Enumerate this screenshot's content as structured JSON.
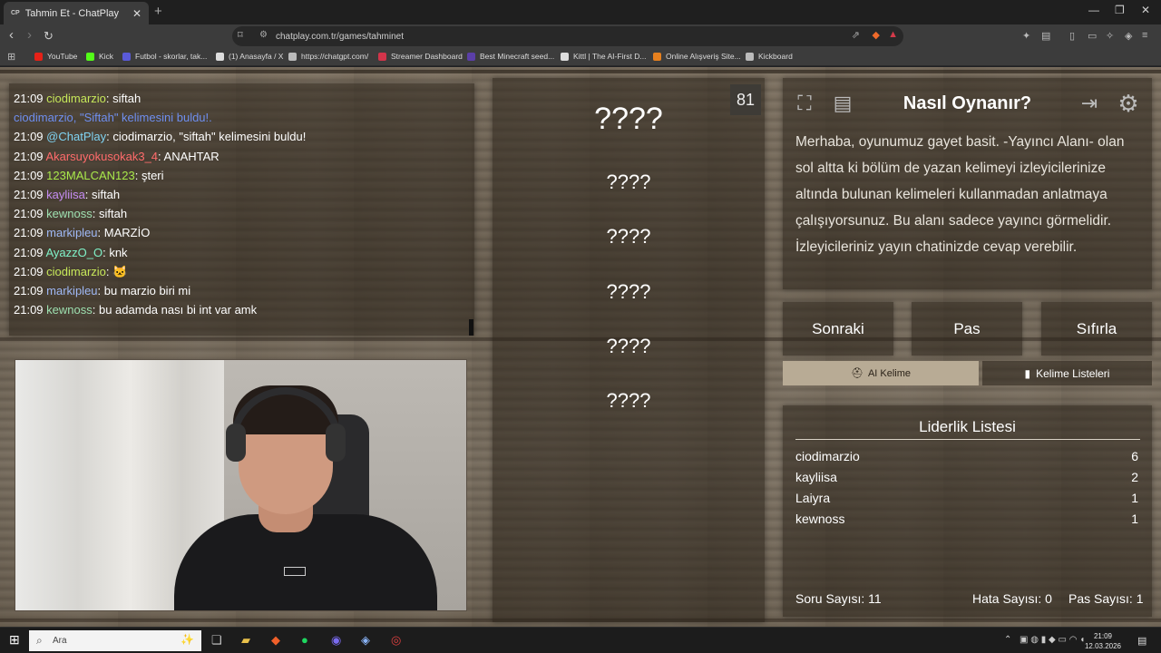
{
  "browser": {
    "tab_title": "Tahmin Et - ChatPlay",
    "tab_favicon": "CP",
    "url": "chatplay.com.tr/games/tahminet",
    "bookmarks": [
      {
        "label": "YouTube",
        "color": "#e62117"
      },
      {
        "label": "Kick",
        "color": "#53fc18"
      },
      {
        "label": "Futbol - skorlar, tak...",
        "color": "#5a5ad8"
      },
      {
        "label": "(1) Anasayfa / X",
        "color": "#dddddd"
      },
      {
        "label": "https://chatgpt.com/",
        "color": "#bbbbbb"
      },
      {
        "label": "Streamer Dashboard",
        "color": "#d2344a"
      },
      {
        "label": "Best Minecraft seed...",
        "color": "#5b3fa8"
      },
      {
        "label": "Kittl | The AI-First D...",
        "color": "#dddddd"
      },
      {
        "label": "Online Alışveriş Site...",
        "color": "#e6801e"
      },
      {
        "label": "Kickboard",
        "color": "#bbbbbb"
      }
    ]
  },
  "chat": [
    {
      "time": "21:09",
      "user": "ciodimarzio",
      "user_color": "#c7e85a",
      "msg": "siftah"
    },
    {
      "time": "",
      "user": "",
      "user_color": "#6f8ff0",
      "msg": "ciodimarzio, \"Siftah\" kelimesini buldu!.",
      "system": true
    },
    {
      "time": "21:09",
      "user": "@ChatPlay",
      "user_color": "#7fd3f2",
      "msg": "ciodimarzio, \"siftah\" kelimesini buldu!"
    },
    {
      "time": "21:09",
      "user": "Akarsuyokusokak3_4",
      "user_color": "#ff6b6b",
      "msg": "ANAHTAR"
    },
    {
      "time": "21:09",
      "user": "123MALCAN123",
      "user_color": "#a8e84a",
      "msg": "şteri"
    },
    {
      "time": "21:09",
      "user": "kayliisa",
      "user_color": "#c58cf2",
      "msg": "siftah"
    },
    {
      "time": "21:09",
      "user": "kewnoss",
      "user_color": "#9ee0b0",
      "msg": "siftah"
    },
    {
      "time": "21:09",
      "user": "markipleu",
      "user_color": "#9fb8f5",
      "msg": "MARZİO"
    },
    {
      "time": "21:09",
      "user": "AyazzO_O",
      "user_color": "#7ff2c8",
      "msg": "knk"
    },
    {
      "time": "21:09",
      "user": "ciodimarzio",
      "user_color": "#c7e85a",
      "msg": "🐱"
    },
    {
      "time": "21:09",
      "user": "markipleu",
      "user_color": "#9fb8f5",
      "msg": "bu marzio biri mi"
    },
    {
      "time": "21:09",
      "user": "kewnoss",
      "user_color": "#9ee0b0",
      "msg": "bu adamda nası bi int var amk"
    }
  ],
  "game": {
    "timer": "81",
    "main_word": "????",
    "forbidden_words": [
      "????",
      "????",
      "????",
      "????",
      "????"
    ]
  },
  "howto": {
    "title": "Nasıl Oynanır?",
    "text": "Merhaba, oyunumuz gayet basit. -Yayıncı Alanı- olan sol altta ki bölüm de yazan kelimeyi izleyicilerinize altında bulunan kelimeleri kullanmadan anlatmaya çalışıyorsunuz. Bu alanı sadece yayıncı görmelidir. İzleyicileriniz yayın chatinizde cevap verebilir."
  },
  "controls": {
    "next": "Sonraki",
    "pass": "Pas",
    "reset": "Sıfırla",
    "ai_word": "AI Kelime",
    "word_lists": "Kelime Listeleri"
  },
  "leaderboard": {
    "title": "Liderlik Listesi",
    "rows": [
      {
        "name": "ciodimarzio",
        "score": "6"
      },
      {
        "name": "kayliisa",
        "score": "2"
      },
      {
        "name": "Laiyra",
        "score": "1"
      },
      {
        "name": "kewnoss",
        "score": "1"
      }
    ]
  },
  "stats": {
    "questions": "Soru Sayısı: 11",
    "errors": "Hata Sayısı: 0",
    "passes": "Pas Sayısı: 1"
  },
  "taskbar": {
    "search_placeholder": "Ara",
    "time": "21:09",
    "date": "12.03.2026"
  }
}
